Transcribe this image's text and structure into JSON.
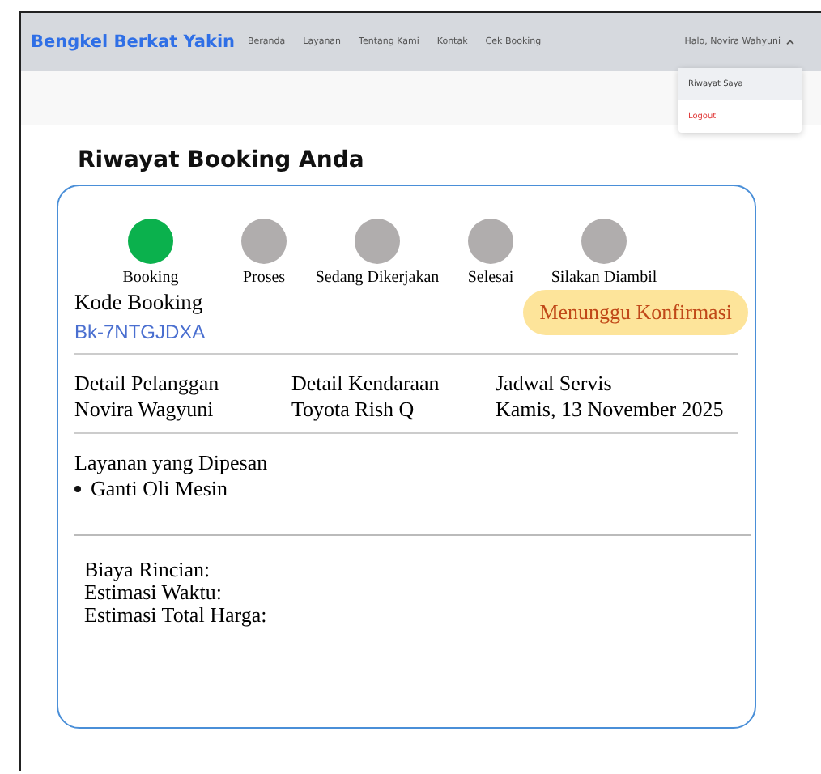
{
  "navbar": {
    "brand": "Bengkel Berkat Yakin",
    "links": [
      "Beranda",
      "Layanan",
      "Tentang Kami",
      "Kontak",
      "Cek Booking"
    ],
    "user": "Halo, Novira Wahyuni",
    "user_menu": {
      "expanded": true,
      "items": [
        {
          "label": "Riwayat Saya",
          "kind": "normal",
          "selected": true
        },
        {
          "label": "Logout",
          "kind": "danger",
          "selected": false
        }
      ]
    }
  },
  "page_title": "Riwayat Booking Anda",
  "booking": {
    "steps": [
      {
        "label": "Booking",
        "done": true
      },
      {
        "label": "Proses",
        "done": false
      },
      {
        "label": "Sedang Dikerjakan",
        "done": false
      },
      {
        "label": "Selesai",
        "done": false
      },
      {
        "label": "Silakan Diambil",
        "done": false
      }
    ],
    "code_label": "Kode Booking",
    "code": "Bk-7NTGJDXA",
    "status": "Menunggu Konfirmasi",
    "details": [
      {
        "title": "Detail Pelanggan",
        "value": "Novira Wagyuni"
      },
      {
        "title": "Detail Kendaraan",
        "value": "Toyota Rish Q"
      },
      {
        "title": "Jadwal Servis",
        "value": "Kamis, 13 November 2025"
      }
    ],
    "services_title": "Layanan yang Dipesan",
    "services": [
      "Ganti Oli Mesin"
    ],
    "summary": [
      "Biaya Rincian:",
      "Estimasi Waktu:",
      "Estimasi Total Harga:"
    ]
  }
}
